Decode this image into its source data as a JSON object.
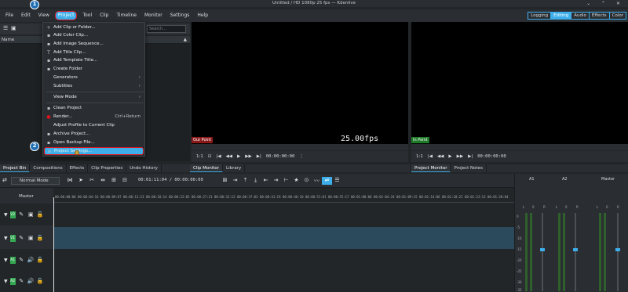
{
  "window": {
    "title": "Untitled / HD 1080p 25 fps — Kdenlive"
  },
  "menubar": {
    "items": [
      "File",
      "Edit",
      "View",
      "Project",
      "Tool",
      "Clip",
      "Timeline",
      "Monitor",
      "Settings",
      "Help"
    ],
    "workspaces": [
      "Logging",
      "Editing",
      "Audio",
      "Effects",
      "Color"
    ]
  },
  "project_menu": {
    "items": [
      {
        "icon": "+",
        "label": "Add Clip or Folder..."
      },
      {
        "icon": "▪",
        "label": "Add Color Clip..."
      },
      {
        "icon": "▪",
        "label": "Add Image Sequence..."
      },
      {
        "icon": "T",
        "label": "Add Title Clip..."
      },
      {
        "icon": "▪",
        "label": "Add Template Title..."
      },
      {
        "icon": "▪",
        "label": "Create Folder"
      },
      {
        "icon": "",
        "label": "Generators",
        "submenu": true
      },
      {
        "icon": "",
        "label": "Subtitles",
        "submenu": true
      },
      {
        "icon": "",
        "label": "View Mode",
        "submenu": true
      },
      {
        "icon": "▪",
        "label": "Clean Project"
      },
      {
        "icon": "●",
        "label": "Render...",
        "shortcut": "Ctrl+Return"
      },
      {
        "icon": "",
        "label": "Adjust Profile to Current Clip"
      },
      {
        "icon": "▪",
        "label": "Archive Project..."
      },
      {
        "icon": "▪",
        "label": "Open Backup File..."
      },
      {
        "icon": "≡",
        "label": "Project Settings..."
      }
    ]
  },
  "bin": {
    "search_placeholder": "Search...",
    "column_name": "Name"
  },
  "clip_monitor": {
    "out_point": "Out Point",
    "fps_timecode": "25.00fps 00:00:00:00",
    "zoom": "1:1",
    "timecode": "00:00:00:00"
  },
  "project_monitor": {
    "in_point": "In Point",
    "zoom": "1:1",
    "timecode": "00:00:00:00"
  },
  "tabs_left": [
    "Project Bin",
    "Compositions",
    "Effects",
    "Clip Properties",
    "Undo History"
  ],
  "tabs_clip": [
    "Clip Monitor",
    "Library"
  ],
  "tabs_proj": [
    "Project Monitor",
    "Project Notes"
  ],
  "timeline": {
    "mode": "Normal Mode",
    "timecode": "00:01:11:04 / 00:00:00:00",
    "master": "Master",
    "ruler": [
      "00:00:00:00",
      "00:00:04:16",
      "00:00:09:07",
      "00:00:13:23",
      "00:00:18:14",
      "00:00:23:05",
      "00:00:27:21",
      "00:00:32:12",
      "00:00:37:03",
      "00:00:41:19",
      "00:00:46:10",
      "00:00:51:01",
      "00:00:55:17",
      "00:01:00:08",
      "00:01:04:24",
      "00:01:09:15",
      "00:01:14:06",
      "00:01:18:22",
      "00:01:23:13",
      "00:01:28:04"
    ],
    "tracks": [
      {
        "tag": "V2",
        "type": "video"
      },
      {
        "tag": "V1",
        "type": "video"
      },
      {
        "tag": "A1",
        "type": "audio"
      },
      {
        "tag": "A2",
        "type": "audio"
      }
    ]
  },
  "mixer": {
    "strips": [
      "A1",
      "A2",
      "Master"
    ],
    "db_scale": [
      "0",
      "-5",
      "-10",
      "-15",
      "-20",
      "-25",
      "-30",
      "-35"
    ],
    "lr": [
      "L",
      "0",
      "R"
    ]
  },
  "annotations": {
    "step1": "1",
    "step2": "2"
  }
}
